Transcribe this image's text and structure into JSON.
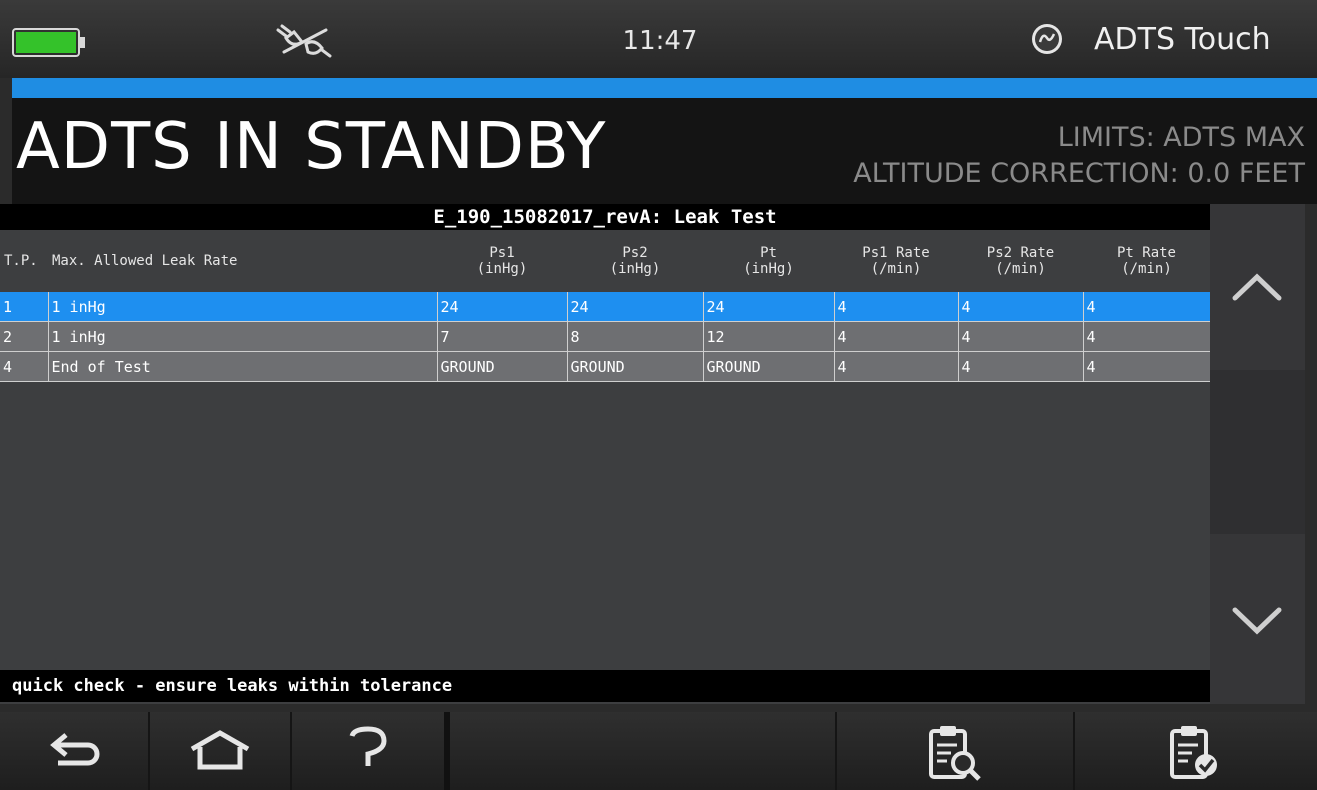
{
  "status_bar": {
    "time": "11:47",
    "app_name": "ADTS Touch",
    "battery_icon": "battery-full-icon",
    "connection_icon": "disconnected-plug-icon",
    "logo_icon": "ge-logo-icon"
  },
  "progress": {
    "fill_percent": 100,
    "color": "#1f8de3"
  },
  "header": {
    "title": "ADTS IN STANDBY",
    "limits": "LIMITS: ADTS MAX",
    "altitude_correction": "ALTITUDE CORRECTION: 0.0 FEET"
  },
  "test": {
    "name": "E_190_15082017_revA: Leak Test",
    "columns": {
      "tp": "T.P.",
      "max_leak": "Max. Allowed Leak Rate",
      "ps1": [
        "Ps1",
        "(inHg)"
      ],
      "ps2": [
        "Ps2",
        "(inHg)"
      ],
      "pt": [
        "Pt",
        "(inHg)"
      ],
      "ps1_rate": [
        "Ps1 Rate",
        "(/min)"
      ],
      "ps2_rate": [
        "Ps2 Rate",
        "(/min)"
      ],
      "pt_rate": [
        "Pt Rate",
        "(/min)"
      ]
    },
    "rows": [
      [
        "1",
        "1 inHg",
        "24",
        "24",
        "24",
        "4",
        "4",
        "4"
      ],
      [
        "2",
        "1 inHg",
        "7",
        "8",
        "12",
        "4",
        "4",
        "4"
      ],
      [
        "4",
        "End of Test",
        "GROUND",
        "GROUND",
        "GROUND",
        "4",
        "4",
        "4"
      ]
    ],
    "selected_row": 0,
    "note": "quick check - ensure leaks within tolerance"
  },
  "nav": {
    "back_icon": "back-arrow-icon",
    "home_icon": "home-icon",
    "help_icon": "help-icon",
    "review_icon": "clipboard-search-icon",
    "run_icon": "clipboard-check-icon"
  },
  "colors": {
    "selected_row": "#1e8ff0",
    "normal_row": "#6e6f72",
    "battery": "#34c22a"
  }
}
